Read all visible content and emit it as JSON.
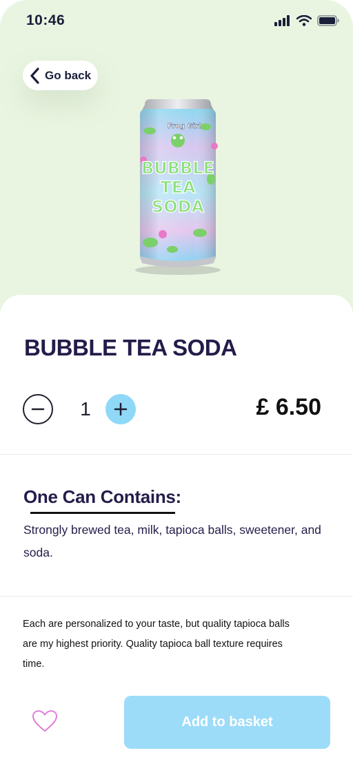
{
  "status_bar": {
    "time": "10:46"
  },
  "nav": {
    "back_label": "Go back"
  },
  "product": {
    "name": "BUBBLE TEA SODA",
    "quantity": "1",
    "price": "£ 6.50",
    "can_brand": "Frog Girl",
    "can_text_1": "BUBBLE",
    "can_text_2": "TEA",
    "can_text_3": "SODA"
  },
  "contains": {
    "title": "One Can Contains:",
    "text": "Strongly brewed tea, milk, tapioca balls, sweetener, and soda."
  },
  "note": {
    "text": "Each are personalized to your taste, but quality tapioca balls are my highest priority. Quality tapioca ball texture requires time."
  },
  "actions": {
    "add_label": "Add to basket"
  },
  "colors": {
    "hero_bg": "#e9f5e0",
    "accent_blue": "#9ddcf9",
    "title_text": "#251c4a",
    "heart": "#e07fd8"
  },
  "icons": {
    "back": "chevron-left-icon",
    "minus": "minus-icon",
    "plus": "plus-icon",
    "favorite": "heart-icon",
    "signal": "signal-icon",
    "wifi": "wifi-icon",
    "battery": "battery-icon"
  }
}
